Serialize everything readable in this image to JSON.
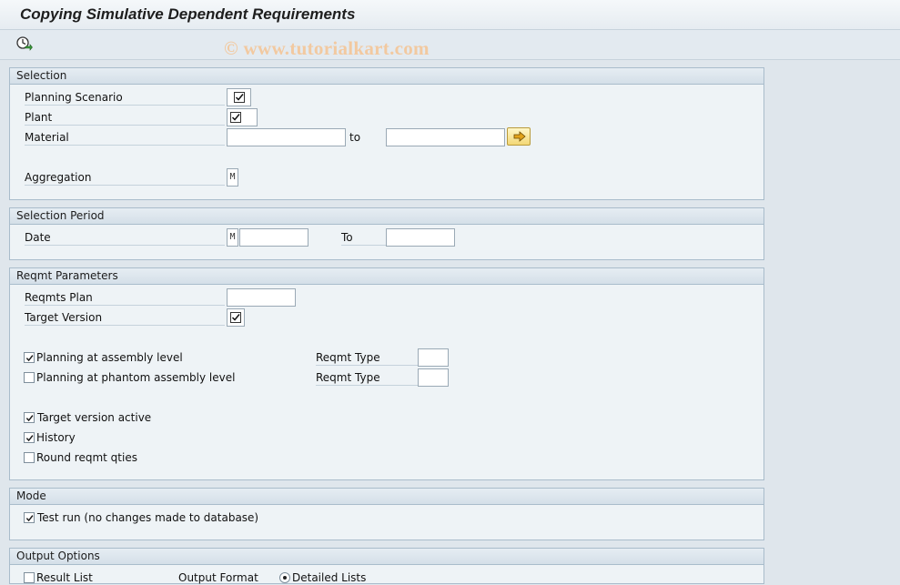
{
  "title": "Copying Simulative Dependent Requirements",
  "watermark": "© www.tutorialkart.com",
  "toolbar": {
    "execute_icon": "clock-execute-icon"
  },
  "selection": {
    "heading": "Selection",
    "planning_scenario_label": "Planning Scenario",
    "plant_label": "Plant",
    "material_label": "Material",
    "material_from": "",
    "to_label": "to",
    "material_to": "",
    "aggregation_label": "Aggregation",
    "aggregation_value": "M"
  },
  "period": {
    "heading": "Selection Period",
    "date_label": "Date",
    "date_prefix": "M",
    "date_from": "",
    "to_label": "To",
    "date_to": ""
  },
  "reqmt": {
    "heading": "Reqmt Parameters",
    "reqmts_plan_label": "Reqmts Plan",
    "target_version_label": "Target Version",
    "assembly_label": "Planning at assembly level",
    "assembly_checked": true,
    "phantom_label": "Planning at phantom assembly level",
    "phantom_checked": false,
    "reqmt_type_label_1": "Reqmt Type",
    "reqmt_type_label_2": "Reqmt Type",
    "target_active_label": "Target version active",
    "target_active_checked": true,
    "history_label": "History",
    "history_checked": true,
    "round_label": "Round reqmt qties",
    "round_checked": false
  },
  "mode": {
    "heading": "Mode",
    "test_run_label": "Test run (no changes made to database)",
    "test_run_checked": true
  },
  "output": {
    "heading": "Output Options",
    "result_list_label": "Result List",
    "result_list_checked": false,
    "output_format_label": "Output Format",
    "detailed_lists_label": "Detailed Lists"
  },
  "colors": {
    "background": "#dfe6ec",
    "group_bg": "#eef3f6",
    "group_border": "#a9bccb",
    "watermark": "#f2c9a0",
    "multi_select": "#f3d776"
  }
}
